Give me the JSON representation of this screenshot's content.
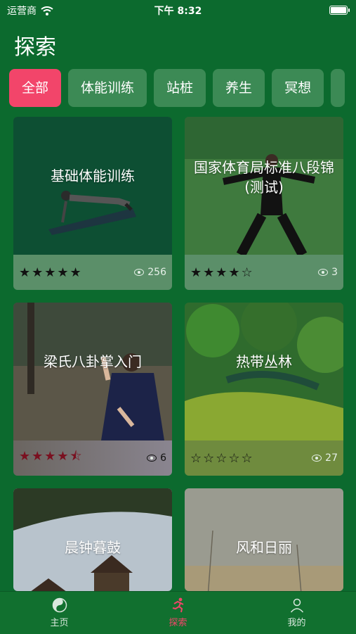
{
  "status": {
    "carrier": "运营商",
    "time": "下午 8:32"
  },
  "page": {
    "title": "探索"
  },
  "filters": [
    "全部",
    "体能训练",
    "站桩",
    "养生",
    "冥想"
  ],
  "cards": [
    {
      "title": "基础体能训练",
      "stars": "★★★★★",
      "views": "256"
    },
    {
      "title": "国家体育局标准八段锦 (测试)",
      "stars": "★★★★☆",
      "views": "3"
    },
    {
      "title": "梁氏八卦掌入门",
      "stars": "★★★★⯪",
      "views": "6"
    },
    {
      "title": "热带丛林",
      "stars": "☆☆☆☆☆",
      "views": "27"
    },
    {
      "title": "晨钟暮鼓",
      "stars": "",
      "views": ""
    },
    {
      "title": "风和日丽",
      "stars": "",
      "views": ""
    }
  ],
  "tabs": [
    {
      "label": "主页",
      "icon": "yin-yang-icon"
    },
    {
      "label": "探索",
      "icon": "run-icon"
    },
    {
      "label": "我的",
      "icon": "user-icon"
    }
  ],
  "colors": {
    "background": "#0c6a2e",
    "accent": "#f2456a",
    "chip": "#3c8a55"
  }
}
